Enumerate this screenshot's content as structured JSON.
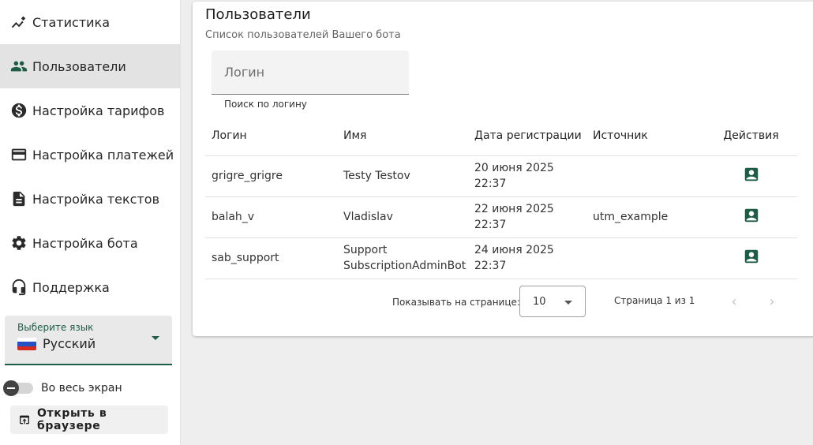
{
  "sidebar": {
    "items": [
      {
        "label": "Статистика",
        "icon": "chart-line-icon"
      },
      {
        "label": "Пользователи",
        "icon": "users-icon",
        "active": true
      },
      {
        "label": "Настройка тарифов",
        "icon": "dollar-icon"
      },
      {
        "label": "Настройка платежей",
        "icon": "credit-card-icon"
      },
      {
        "label": "Настройка текстов",
        "icon": "document-icon"
      },
      {
        "label": "Настройка бота",
        "icon": "gear-icon"
      },
      {
        "label": "Поддержка",
        "icon": "headset-icon"
      }
    ],
    "language": {
      "label": "Выберите язык",
      "value": "Русский",
      "flag": "russia-flag-icon"
    },
    "fullscreen_label": "Во весь экран",
    "open_browser_label": "Открыть в браузере"
  },
  "main": {
    "title": "Пользователи",
    "subtitle": "Список пользователей Вашего бота",
    "search": {
      "placeholder": "Логин",
      "value": "",
      "hint": "Поиск по логину"
    },
    "table": {
      "columns": [
        "Логин",
        "Имя",
        "Дата регистрации",
        "Источник",
        "Действия"
      ],
      "rows": [
        {
          "login": "grigre_grigre",
          "name": "Testy Testov",
          "date": "20 июня 2025 22:37",
          "source": ""
        },
        {
          "login": "balah_v",
          "name": "Vladislav",
          "date": "22 июня 2025 22:37",
          "source": "utm_example"
        },
        {
          "login": "sab_support",
          "name": "Support SubscriptionAdminBot",
          "date": "24 июня 2025 22:37",
          "source": ""
        }
      ]
    },
    "pagination": {
      "per_page_label": "Показывать на странице:",
      "per_page_value": "10",
      "page_info": "Страница 1 из 1"
    }
  },
  "colors": {
    "accent": "#1d5c45",
    "active_bg": "#e3e3e3"
  }
}
